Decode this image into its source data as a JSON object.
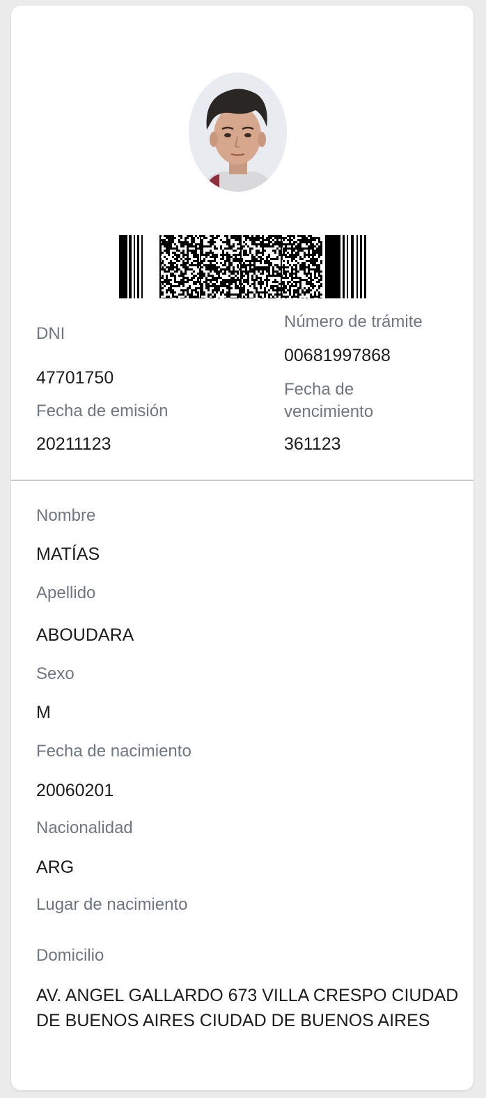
{
  "card": {
    "photo": {
      "description_icon": "profile-photo"
    },
    "barcode": {
      "type": "pdf417"
    },
    "dni": {
      "label": "DNI",
      "value": "47701750"
    },
    "numero_tramite": {
      "label": "Número de trámite",
      "value": "00681997868"
    },
    "fecha_emision": {
      "label": "Fecha de emisión",
      "value": "20211123"
    },
    "fecha_vencimiento": {
      "label_line1": "Fecha de",
      "label_line2": "vencimiento",
      "value": "361123"
    },
    "nombre": {
      "label": "Nombre",
      "value": "MATÍAS"
    },
    "apellido": {
      "label": "Apellido",
      "value": "ABOUDARA"
    },
    "sexo": {
      "label": "Sexo",
      "value": "M"
    },
    "fecha_nacimiento": {
      "label": "Fecha de nacimiento",
      "value": "20060201"
    },
    "nacionalidad": {
      "label": "Nacionalidad",
      "value": "ARG"
    },
    "lugar_nacimiento": {
      "label": "Lugar de nacimiento",
      "value": ""
    },
    "domicilio": {
      "label": "Domicilio",
      "line1": "AV. ANGEL GALLARDO 673 VILLA CRESPO CIUDAD",
      "line2": "DE BUENOS AIRES CIUDAD DE BUENOS AIRES"
    }
  },
  "colors": {
    "label": "#6e7681",
    "value": "#1c1c1c",
    "background": "#ebebeb",
    "card": "#ffffff"
  }
}
